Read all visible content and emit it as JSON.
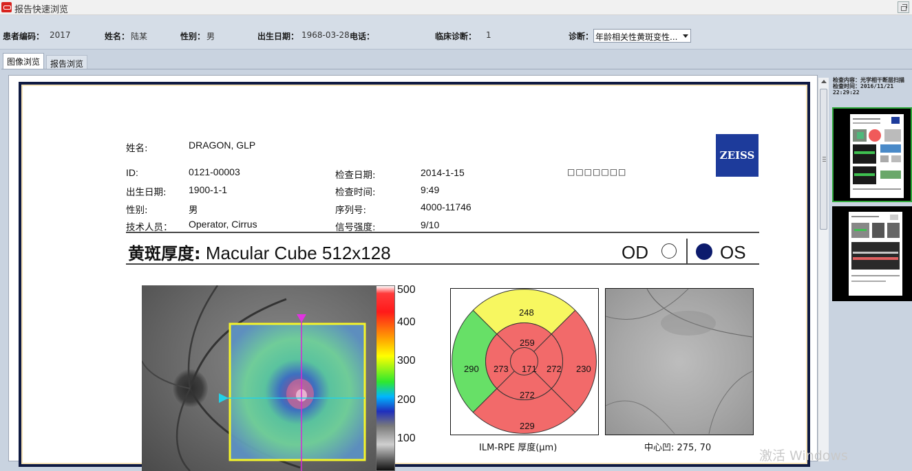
{
  "window": {
    "title": "报告快速浏览"
  },
  "patient_bar": {
    "id_label": "患者编码：",
    "id_value": "2017",
    "name_label": "姓名：",
    "name_value": "陆某",
    "sex_label": "性别：",
    "sex_value": "男",
    "dob_label": "出生日期：",
    "dob_value": "1968-03-28",
    "phone_label": "电话：",
    "phone_value": "",
    "clinical_label": "临床诊断：",
    "clinical_value": "1",
    "diag_label": "诊断：",
    "diag_value": "年龄相关性黄斑变性..."
  },
  "tabs": [
    {
      "label": "图像浏览"
    },
    {
      "label": "报告浏览"
    }
  ],
  "right_panel": {
    "meta_line1": "检查内容：光学相干断层扫描",
    "meta_line2": "检查时间：2016/11/21",
    "meta_line3": "22:29:22"
  },
  "report": {
    "name_label": "姓名:",
    "name_value": "DRAGON, GLP",
    "id_label": "ID:",
    "id_value": "0121-00003",
    "dob_label": "出生日期:",
    "dob_value": "1900-1-1",
    "sex_label": "性别:",
    "sex_value": "男",
    "tech_label": "技术人员：",
    "tech_value": "Operator, Cirrus",
    "exam_date_label": "检查日期:",
    "exam_date_value": "2014-1-15",
    "exam_time_label": "检查时间:",
    "exam_time_value": "9:49",
    "serial_label": "序列号:",
    "serial_value": "4000-11746",
    "signal_label": "信号强度:",
    "signal_value": "9/10",
    "placeholder_boxes": "□□□□□□□",
    "logo_text": "ZEISS",
    "heading_cn": "黄斑厚度:",
    "heading_en": "Macular Cube 512x128",
    "od_label": "OD",
    "os_label": "OS",
    "colorbar_labels": [
      "500",
      "400",
      "300",
      "200",
      "100"
    ],
    "etdrs": {
      "center": "171",
      "inner_superior": "259",
      "inner_nasal": "273",
      "inner_temporal": "272",
      "inner_inferior": "272",
      "outer_superior": "248",
      "outer_nasal": "290",
      "outer_temporal": "230",
      "outer_inferior": "229",
      "caption": "ILM-RPE 厚度(µm)",
      "colors": {
        "yellow": "#f7f760",
        "red": "#f26a6a",
        "green": "#67e067"
      }
    },
    "slo_caption": "中心凹: 275, 70"
  },
  "watermark": "激活 Windows"
}
